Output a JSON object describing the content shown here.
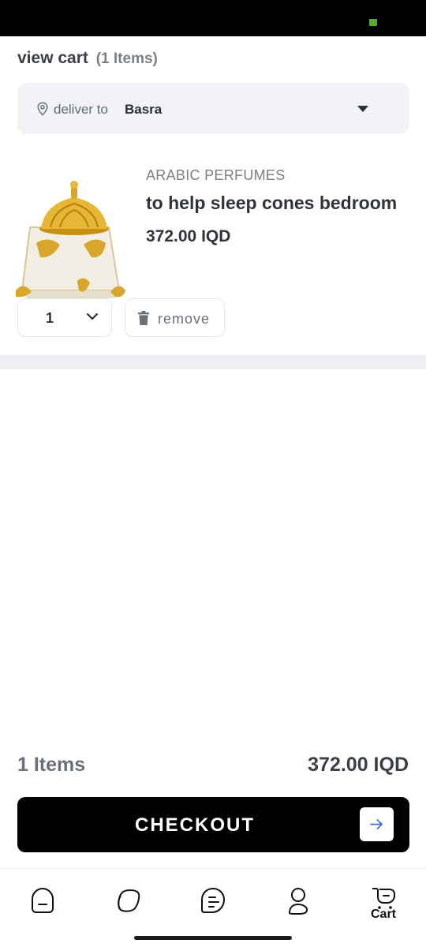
{
  "header": {
    "title": "view cart",
    "item_count_label": "(1 Items)",
    "deliver_label": "deliver to",
    "deliver_city": "Basra"
  },
  "item": {
    "category": "ARABIC PERFUMES",
    "name": "to help sleep cones bedroom",
    "price": "372.00 IQD",
    "quantity": "1",
    "remove_label": "remove"
  },
  "summary": {
    "count": "1 Items",
    "total": "372.00 IQD"
  },
  "checkout": {
    "label": "CHECKOUT"
  },
  "nav": {
    "items": [
      "home-icon",
      "categories-icon",
      "orders-icon",
      "profile-icon",
      "cart-icon"
    ],
    "cart_label": "Cart"
  },
  "colors": {
    "accent": "#000000",
    "status_battery": "#4caf2a",
    "arrow": "#3f6fd8"
  }
}
